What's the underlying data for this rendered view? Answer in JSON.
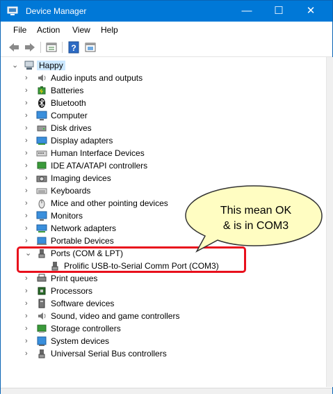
{
  "window": {
    "title": "Device Manager",
    "minimize": "—",
    "maximize": "☐",
    "close": "✕"
  },
  "menu": {
    "file": "File",
    "action": "Action",
    "view": "View",
    "help": "Help"
  },
  "tree": {
    "root": "Happy",
    "items": [
      "Audio inputs and outputs",
      "Batteries",
      "Bluetooth",
      "Computer",
      "Disk drives",
      "Display adapters",
      "Human Interface Devices",
      "IDE ATA/ATAPI controllers",
      "Imaging devices",
      "Keyboards",
      "Mice and other pointing devices",
      "Monitors",
      "Network adapters",
      "Portable Devices",
      "Ports (COM & LPT)",
      "Prolific USB-to-Serial Comm Port (COM3)",
      "Print queues",
      "Processors",
      "Software devices",
      "Sound, video and game controllers",
      "Storage controllers",
      "System devices",
      "Universal Serial Bus controllers"
    ]
  },
  "callout": {
    "line1": "This mean OK",
    "line2": "& is in COM3"
  },
  "colors": {
    "titlebar": "#0078d7",
    "highlight_border": "#e8101c",
    "bubble_fill": "#fffdc2"
  }
}
